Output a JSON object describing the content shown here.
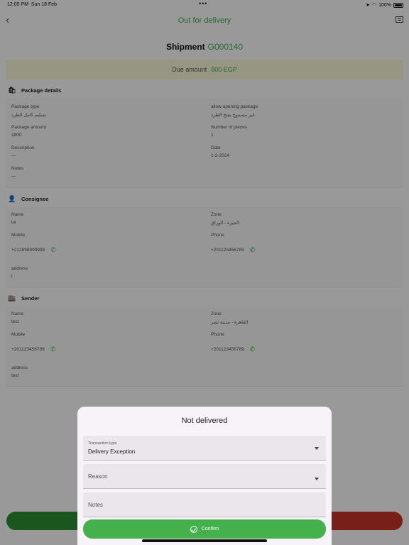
{
  "status_bar": {
    "time": "12:05 PM",
    "date": "Sun 18 Feb",
    "battery": "100%"
  },
  "nav": {
    "title": "Out for delivery"
  },
  "shipment": {
    "label": "Shipment",
    "code": "G000140"
  },
  "due": {
    "label": "Due amount",
    "amount": "800 EGP"
  },
  "package": {
    "title": "Package details",
    "fields": [
      {
        "label": "Package type",
        "value": "تسليم كامل الطرد"
      },
      {
        "label": "allow opening package",
        "value": "غير مسموح بفتح الطرد"
      },
      {
        "label": "Package amount",
        "value": "1800"
      },
      {
        "label": "Number of pieces",
        "value": "1"
      },
      {
        "label": "Description",
        "value": "—"
      },
      {
        "label": "Date",
        "value": "1-2-2024"
      },
      {
        "label": "Notes",
        "value": "—"
      }
    ]
  },
  "consignee": {
    "title": "Consignee",
    "name_label": "Name",
    "name": "loi",
    "zone_label": "Zone",
    "zone": "الجيزة - الوراق",
    "mobile_label": "Mobile",
    "mobile": "+212898999999",
    "phone_label": "Phone",
    "phone": "+201123456789",
    "address_label": "address",
    "address": "t"
  },
  "sender": {
    "title": "Sender",
    "name_label": "Name",
    "name": "test",
    "zone_label": "Zone",
    "zone": "القاهرة - مدينة نصر",
    "mobile_label": "Mobile",
    "mobile": "+201123456789",
    "phone_label": "Phone",
    "phone": "+201123456789",
    "address_label": "address",
    "address": "test"
  },
  "modal": {
    "title": "Not delivered",
    "transaction_label": "Transaction type",
    "transaction_value": "Delivery Exception",
    "reason_placeholder": "Reason",
    "notes_placeholder": "Notes",
    "confirm_label": "Confirm"
  }
}
